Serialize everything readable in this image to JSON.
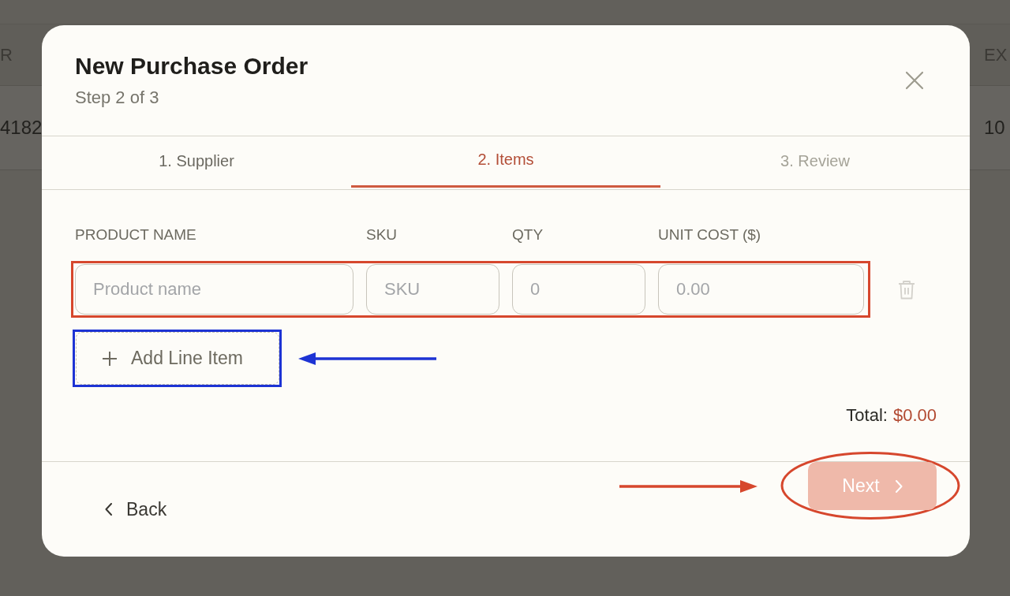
{
  "background_table": {
    "columns": [
      "R",
      "EX"
    ],
    "rows": [
      {
        "cells": [
          "4182",
          "10"
        ]
      }
    ]
  },
  "dialog": {
    "title": "New Purchase Order",
    "subtitle": "Step 2 of 3",
    "tabs": [
      {
        "label": "1. Supplier",
        "selected": false,
        "disabled": false
      },
      {
        "label": "2. Items",
        "selected": true,
        "disabled": false
      },
      {
        "label": "3. Review",
        "selected": false,
        "disabled": true
      }
    ],
    "columns": [
      "PRODUCT NAME",
      "SKU",
      "QTY",
      "UNIT COST ($)"
    ],
    "line_items": [
      {
        "fields": [
          {
            "placeholder": "Product name"
          },
          {
            "placeholder": "SKU"
          },
          {
            "placeholder": "0"
          },
          {
            "placeholder": "0.00"
          }
        ],
        "annotation": {
          "kind": "frame",
          "color": "#d6472d"
        }
      }
    ],
    "add_button": {
      "label": "Add Line Item",
      "annotation": {
        "kind": "frame",
        "color": "#1d33d4",
        "arrow": {
          "kind": "leftward"
        }
      }
    },
    "total": {
      "label": "Total:",
      "amount": "$0.00"
    },
    "back_button": {
      "label": "Back"
    },
    "next_button": {
      "label": "Next",
      "disabled": true,
      "annotation": {
        "kind": "ellipse",
        "color": "#d6472d",
        "arrow": {
          "kind": "rightward"
        }
      }
    }
  }
}
